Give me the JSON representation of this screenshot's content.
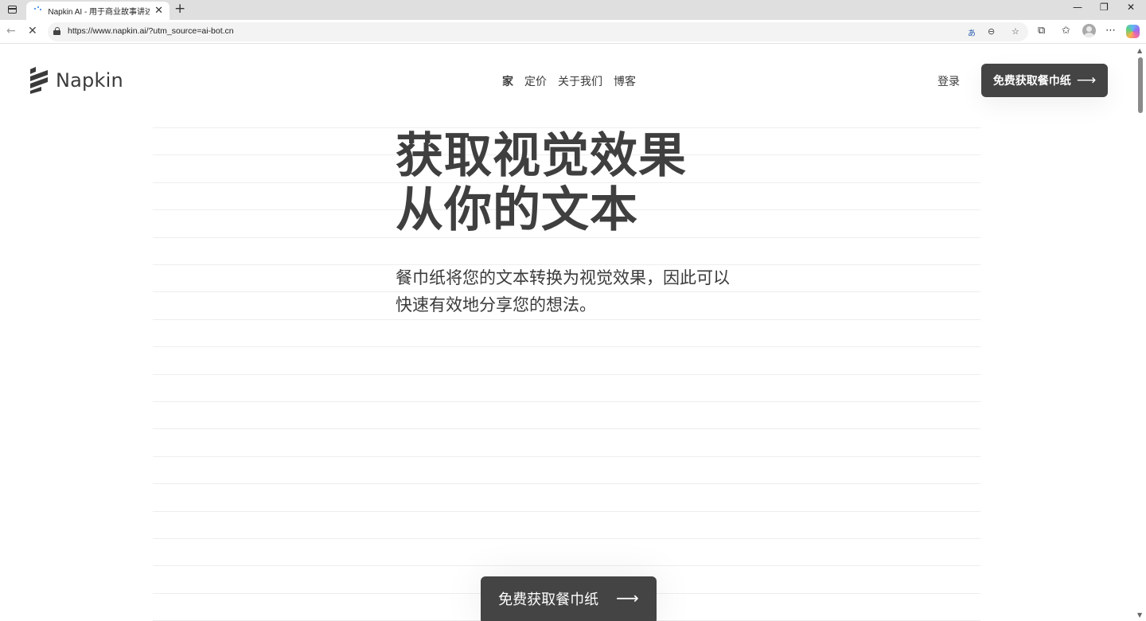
{
  "browser": {
    "tab_title": "Napkin AI - 用于商业故事讲述的",
    "tab_close": "✕",
    "new_tab": "+",
    "url": "https://www.napkin.ai/?utm_source=ai-bot.cn",
    "window_controls": {
      "minimize": "—",
      "restore": "❐",
      "close": "✕"
    },
    "nav": {
      "back": "←",
      "reload": "✕"
    },
    "translate_label": "a̅",
    "icons": [
      "sidebar-toggle-icon",
      "loading-spinner-icon",
      "lock-icon",
      "translate-icon",
      "reader-icon",
      "favorite-star-icon",
      "extensions-icon",
      "favorites-icon",
      "avatar",
      "more-icon",
      "copilot-icon"
    ]
  },
  "site": {
    "logo_text": "Napkin",
    "nav": [
      {
        "label": "家",
        "active": true
      },
      {
        "label": "定价",
        "active": false
      },
      {
        "label": "关于我们",
        "active": false
      },
      {
        "label": "博客",
        "active": false
      }
    ],
    "login": "登录",
    "cta_top": "免费获取餐巾纸",
    "arrow": "⟶",
    "hero": {
      "title_line1": "获取视觉效果",
      "title_line2": "从你的文本",
      "subtitle": "餐巾纸将您的文本转换为视觉效果，因此可以快速有效地分享您的想法。"
    },
    "cta_bottom": "免费获取餐巾纸"
  },
  "colors": {
    "button_bg": "#444444",
    "text": "#3a3a3a",
    "rule_lines": "#eeeeee",
    "tab_strip": "#dfdfdf"
  }
}
